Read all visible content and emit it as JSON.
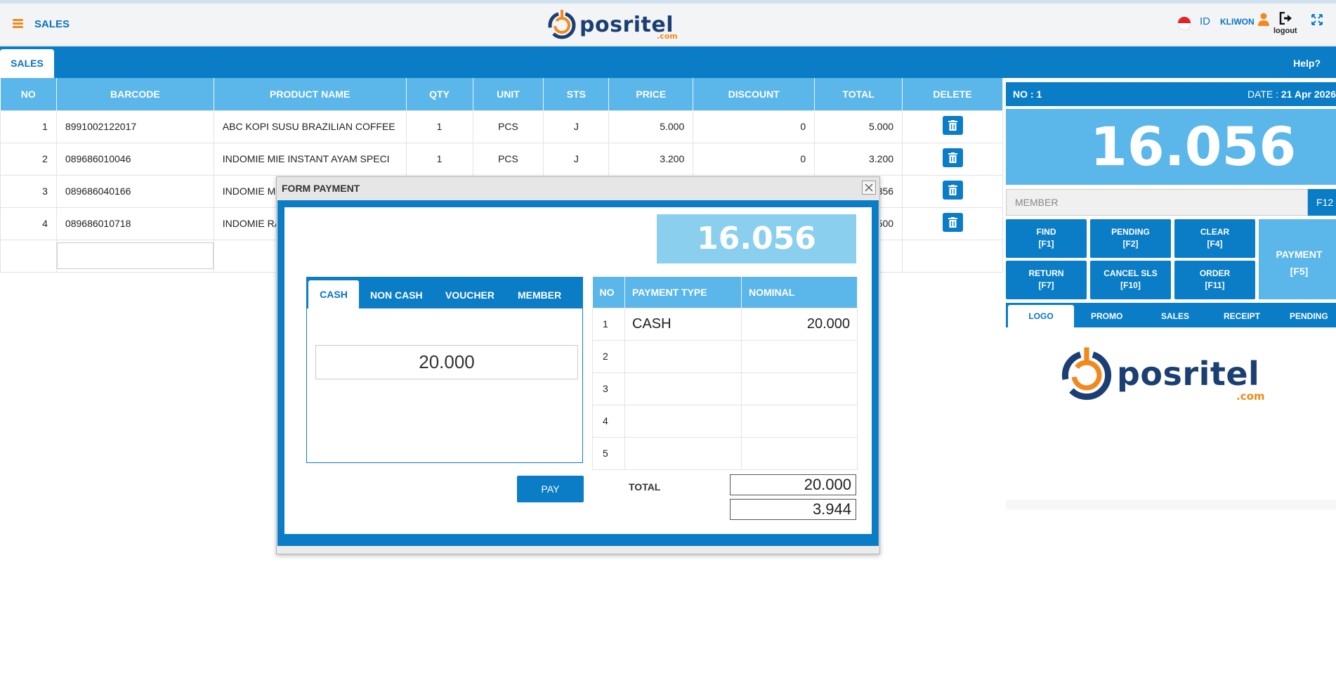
{
  "header": {
    "title": "SALES",
    "logo_text": "posritel",
    "logo_sub": ".com",
    "lang": "ID",
    "user": "KLIWON",
    "logout_label": "logout"
  },
  "tabs": {
    "sales": "SALES",
    "help": "Help?"
  },
  "grid": {
    "columns": [
      "NO",
      "BARCODE",
      "PRODUCT NAME",
      "QTY",
      "UNIT",
      "STS",
      "PRICE",
      "DISCOUNT",
      "TOTAL",
      "DELETE"
    ],
    "rows": [
      {
        "no": "1",
        "barcode": "8991002122017",
        "product": "ABC KOPI SUSU BRAZILIAN COFFEE",
        "qty": "1",
        "unit": "PCS",
        "sts": "J",
        "price": "5.000",
        "discount": "0",
        "total": "5.000"
      },
      {
        "no": "2",
        "barcode": "089686010046",
        "product": "INDOMIE MIE INSTANT AYAM SPECI",
        "qty": "1",
        "unit": "PCS",
        "sts": "J",
        "price": "3.200",
        "discount": "0",
        "total": "3.200"
      },
      {
        "no": "3",
        "barcode": "089686040166",
        "product": "INDOMIE M",
        "qty": "",
        "unit": "",
        "sts": "",
        "price": "",
        "discount": "",
        "total": "356"
      },
      {
        "no": "4",
        "barcode": "089686010718",
        "product": "INDOMIE RA",
        "qty": "",
        "unit": "",
        "sts": "",
        "price": "",
        "discount": "",
        "total": "500"
      }
    ]
  },
  "panel": {
    "no_label": "NO : 1",
    "date_label": "DATE : ",
    "date_value": "21 Apr 2026",
    "total": "16.056",
    "member_placeholder": "MEMBER",
    "member_key": "F12",
    "buttons": [
      {
        "label": "FIND",
        "key": "[F1]"
      },
      {
        "label": "PENDING",
        "key": "[F2]"
      },
      {
        "label": "CLEAR",
        "key": "[F4]"
      },
      {
        "label": "RETURN",
        "key": "[F7]"
      },
      {
        "label": "CANCEL SLS",
        "key": "[F10]"
      },
      {
        "label": "ORDER",
        "key": "[F11]"
      }
    ],
    "payment": {
      "label": "PAYMENT",
      "key": "[F5]"
    },
    "bottom_tabs": [
      "LOGO",
      "PROMO",
      "SALES",
      "RECEIPT",
      "PENDING"
    ]
  },
  "modal": {
    "title": "FORM PAYMENT",
    "total": "16.056",
    "tabs": [
      "CASH",
      "NON CASH",
      "VOUCHER",
      "MEMBER"
    ],
    "cash_value": "20.000",
    "pay_label": "PAY",
    "table_columns": [
      "NO",
      "PAYMENT TYPE",
      "NOMINAL"
    ],
    "rows": [
      {
        "no": "1",
        "type": "CASH",
        "nominal": "20.000"
      },
      {
        "no": "2",
        "type": "",
        "nominal": ""
      },
      {
        "no": "3",
        "type": "",
        "nominal": ""
      },
      {
        "no": "4",
        "type": "",
        "nominal": ""
      },
      {
        "no": "5",
        "type": "",
        "nominal": ""
      }
    ],
    "total_label": "TOTAL",
    "total_paid": "20.000",
    "change": "3.944"
  },
  "colors": {
    "primary": "#0b7dc6",
    "light": "#5bb6ea",
    "accent": "#f08a1c"
  },
  "icons": [
    "menu-icon",
    "flag-icon",
    "user-icon",
    "logout-icon",
    "fullscreen-icon",
    "trash-icon",
    "close-icon"
  ]
}
